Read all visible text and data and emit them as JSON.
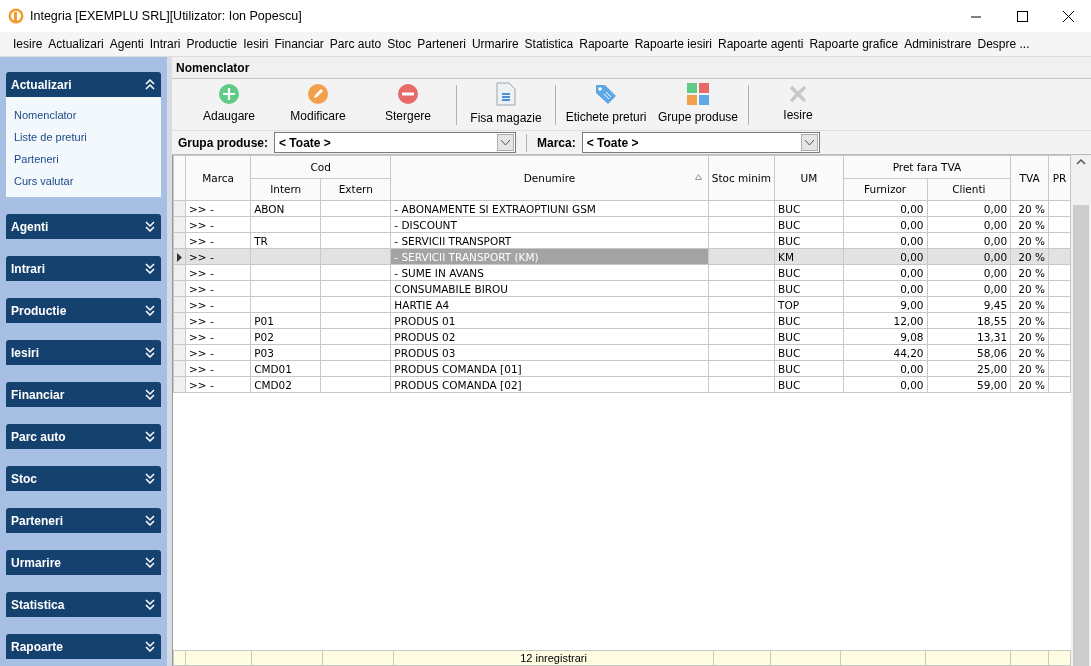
{
  "window": {
    "title": "Integria [EXEMPLU SRL][Utilizator: Ion Popescu]"
  },
  "menu": [
    "Iesire",
    "Actualizari",
    "Agenti",
    "Intrari",
    "Productie",
    "Iesiri",
    "Financiar",
    "Parc auto",
    "Stoc",
    "Parteneri",
    "Urmarire",
    "Statistica",
    "Rapoarte",
    "Rapoarte iesiri",
    "Rapoarte agenti",
    "Rapoarte grafice",
    "Administrare",
    "Despre ..."
  ],
  "sidebar": [
    {
      "title": "Actualizari",
      "expanded": true,
      "items": [
        "Nomenclator",
        "Liste de preturi",
        "Parteneri",
        "Curs valutar"
      ]
    },
    {
      "title": "Agenti",
      "expanded": false
    },
    {
      "title": "Intrari",
      "expanded": false
    },
    {
      "title": "Productie",
      "expanded": false
    },
    {
      "title": "Iesiri",
      "expanded": false
    },
    {
      "title": "Financiar",
      "expanded": false
    },
    {
      "title": "Parc auto",
      "expanded": false
    },
    {
      "title": "Stoc",
      "expanded": false
    },
    {
      "title": "Parteneri",
      "expanded": false
    },
    {
      "title": "Urmarire",
      "expanded": false
    },
    {
      "title": "Statistica",
      "expanded": false
    },
    {
      "title": "Rapoarte",
      "expanded": false
    }
  ],
  "panel": {
    "title": "Nomenclator"
  },
  "toolbar": [
    {
      "kind": "add",
      "label": "Adaugare"
    },
    {
      "kind": "edit",
      "label": "Modificare"
    },
    {
      "kind": "delete",
      "label": "Stergere",
      "separator_after": true
    },
    {
      "kind": "document",
      "label": "Fisa magazie",
      "separator_after": true
    },
    {
      "kind": "tag",
      "label": "Etichete preturi"
    },
    {
      "kind": "groups",
      "label": "Grupe produse",
      "separator_after": true
    },
    {
      "kind": "exit",
      "label": "Iesire"
    }
  ],
  "filters": [
    {
      "label": "Grupa produse:",
      "value": "< Toate >"
    },
    {
      "label": "Marca:",
      "value": "< Toate >"
    }
  ],
  "table": {
    "columns": [
      {
        "label": "Marca"
      },
      {
        "group": "Cod",
        "children": [
          {
            "label": "Intern"
          },
          {
            "label": "Extern"
          }
        ]
      },
      {
        "label": "Denumire",
        "sorted": true
      },
      {
        "label": "Stoc minim"
      },
      {
        "label": "UM"
      },
      {
        "group": "Pret fara TVA",
        "children": [
          {
            "label": "Furnizor"
          },
          {
            "label": "Clienti"
          }
        ]
      },
      {
        "label": "TVA"
      },
      {
        "label": "PR"
      }
    ],
    "rows": [
      {
        "selected": false,
        "marca": ">> -",
        "intern": "ABON",
        "denumire": "- ABONAMENTE SI EXTRAOPTIUNI GSM",
        "um": "BUC",
        "furnizor": "0,00",
        "clienti": "0,00",
        "tva": "20 %"
      },
      {
        "selected": false,
        "marca": ">> -",
        "denumire": "- DISCOUNT",
        "um": "BUC",
        "furnizor": "0,00",
        "clienti": "0,00",
        "tva": "20 %"
      },
      {
        "selected": false,
        "marca": ">> -",
        "intern": "TR",
        "denumire": "- SERVICII TRANSPORT",
        "um": "BUC",
        "furnizor": "0,00",
        "clienti": "0,00",
        "tva": "20 %"
      },
      {
        "selected": true,
        "marca": ">> -",
        "denumire": "- SERVICII TRANSPORT (KM)",
        "um": "KM",
        "furnizor": "0,00",
        "clienti": "0,00",
        "tva": "20 %"
      },
      {
        "selected": false,
        "marca": ">> -",
        "denumire": "- SUME IN AVANS",
        "um": "BUC",
        "furnizor": "0,00",
        "clienti": "0,00",
        "tva": "20 %"
      },
      {
        "selected": false,
        "marca": ">> -",
        "denumire": "CONSUMABILE BIROU",
        "um": "BUC",
        "furnizor": "0,00",
        "clienti": "0,00",
        "tva": "20 %"
      },
      {
        "selected": false,
        "marca": ">> -",
        "denumire": "HARTIE A4",
        "um": "TOP",
        "furnizor": "9,00",
        "clienti": "9,45",
        "tva": "20 %"
      },
      {
        "selected": false,
        "marca": ">> -",
        "intern": "P01",
        "denumire": "PRODUS 01",
        "um": "BUC",
        "furnizor": "12,00",
        "clienti": "18,55",
        "tva": "20 %"
      },
      {
        "selected": false,
        "marca": ">> -",
        "intern": "P02",
        "denumire": "PRODUS 02",
        "um": "BUC",
        "furnizor": "9,08",
        "clienti": "13,31",
        "tva": "20 %"
      },
      {
        "selected": false,
        "marca": ">> -",
        "intern": "P03",
        "denumire": "PRODUS 03",
        "um": "BUC",
        "furnizor": "44,20",
        "clienti": "58,06",
        "tva": "20 %"
      },
      {
        "selected": false,
        "marca": ">> -",
        "intern": "CMD01",
        "denumire": "PRODUS COMANDA [01]",
        "um": "BUC",
        "furnizor": "0,00",
        "clienti": "25,00",
        "tva": "20 %"
      },
      {
        "selected": false,
        "marca": ">> -",
        "intern": "CMD02",
        "denumire": "PRODUS COMANDA [02]",
        "um": "BUC",
        "furnizor": "0,00",
        "clienti": "59,00",
        "tva": "20 %"
      }
    ],
    "footer": "12 inregistrari"
  }
}
